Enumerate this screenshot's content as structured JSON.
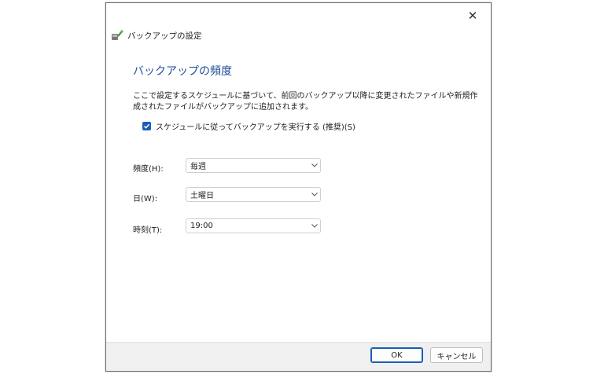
{
  "window": {
    "title": "バックアップの設定",
    "close_glyph": "✕"
  },
  "main": {
    "heading": "バックアップの頻度",
    "description": "ここで設定するスケジュールに基づいて、前回のバックアップ以降に変更されたファイルや新規作成されたファイルがバックアップに追加されます。",
    "schedule_checkbox": {
      "label": "スケジュールに従ってバックアップを実行する (推奨)(S)",
      "checked": true
    }
  },
  "form": {
    "frequency": {
      "label": "頻度(H):",
      "value": "毎週"
    },
    "day": {
      "label": "日(W):",
      "value": "土曜日"
    },
    "time": {
      "label": "時刻(T):",
      "value": "19:00"
    }
  },
  "footer": {
    "ok_label": "OK",
    "cancel_label": "キャンセル"
  },
  "colors": {
    "heading": "#1f4e96",
    "accent": "#1a5fb4",
    "footer_bg": "#f0f0f0"
  }
}
